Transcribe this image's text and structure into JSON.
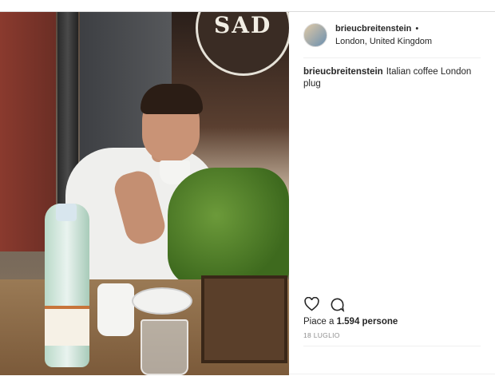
{
  "post": {
    "username": "brieucbreitenstein",
    "separator": "•",
    "location": "London, United Kingdom",
    "caption_user": "brieucbreitenstein",
    "caption_text": "Italian coffee London plug",
    "likes_prefix": "Piace a",
    "likes_count": "1.594 persone",
    "date": "18 LUGLIO"
  },
  "photo": {
    "sign_text": "SAD"
  },
  "icons": {
    "like": "heart-icon",
    "comment": "comment-icon"
  }
}
